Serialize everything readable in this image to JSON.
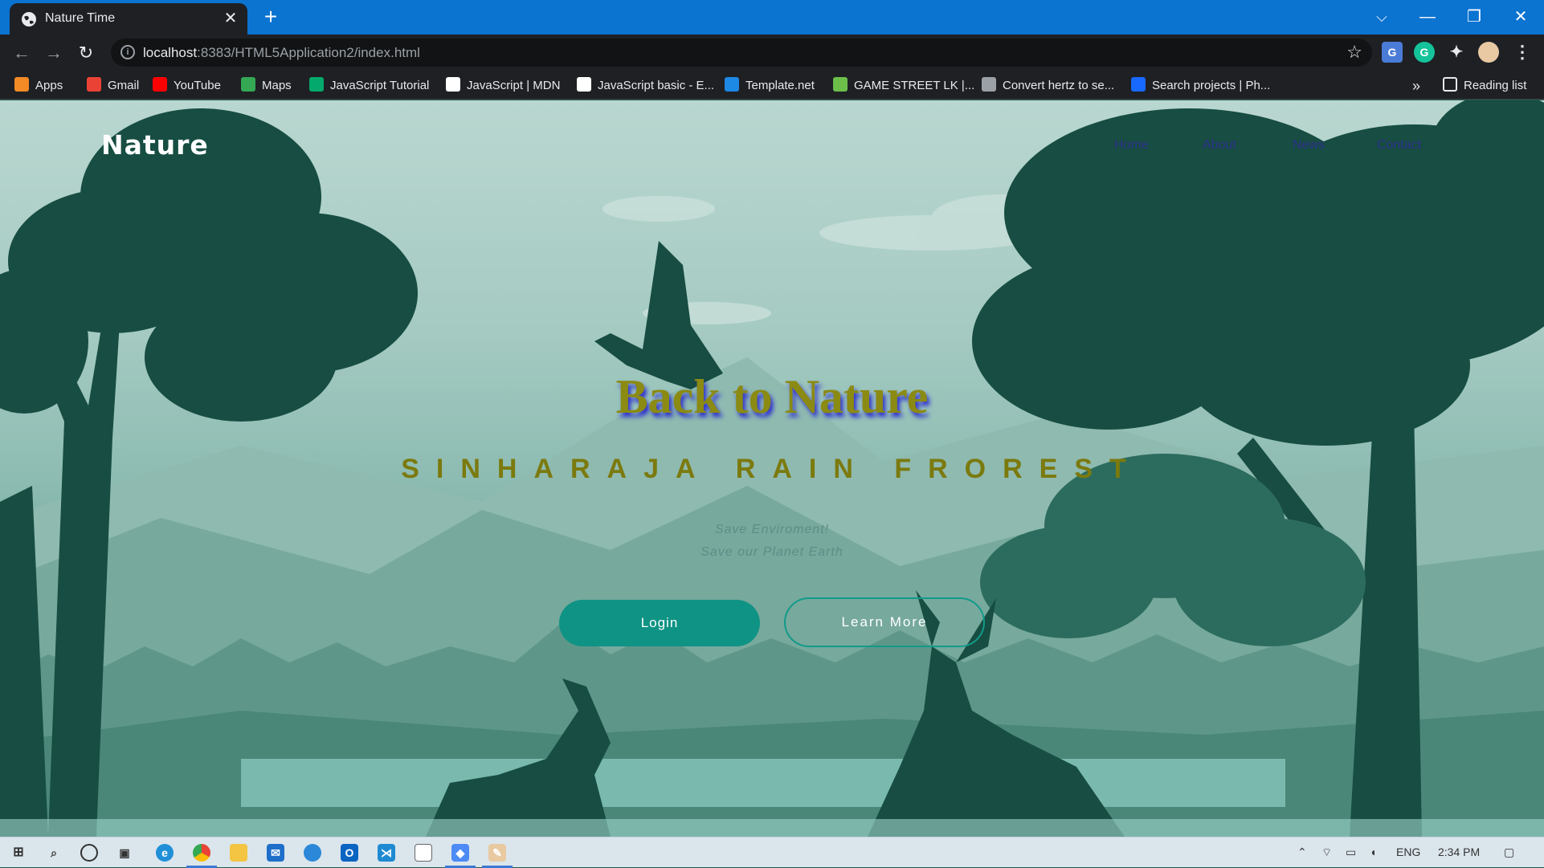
{
  "browser": {
    "tab_title": "Nature Time",
    "tab_close": "✕",
    "new_tab": "+",
    "url_host": "localhost",
    "url_path": ":8383/HTML5Application2/index.html",
    "window_controls": {
      "collapse": "⌵",
      "minimize": "—",
      "restore": "❐",
      "close": "✕"
    },
    "nav": {
      "back": "←",
      "forward": "→",
      "reload": "↻"
    },
    "star": "☆",
    "menu": "⋮",
    "bookmarks_more": "»",
    "reading_list": "Reading list",
    "bookmarks": [
      {
        "label": "Apps",
        "icon": "apps-grid-icon",
        "color": "#f28b25"
      },
      {
        "label": "Gmail",
        "icon": "gmail-icon",
        "color": "#ea4335"
      },
      {
        "label": "YouTube",
        "icon": "youtube-icon",
        "color": "#ff0000"
      },
      {
        "label": "Maps",
        "icon": "maps-pin-icon",
        "color": "#34a853"
      },
      {
        "label": "JavaScript Tutorial",
        "icon": "w3schools-icon",
        "color": "#04aa6d"
      },
      {
        "label": "JavaScript | MDN",
        "icon": "mdn-icon",
        "color": "#ffffff"
      },
      {
        "label": "JavaScript basic - E...",
        "icon": "globe-icon",
        "color": "#ffffff"
      },
      {
        "label": "Template.net",
        "icon": "template-icon",
        "color": "#1e88e5"
      },
      {
        "label": "GAME STREET LK |...",
        "icon": "gamestreet-icon",
        "color": "#6cc04a"
      },
      {
        "label": "Convert hertz to se...",
        "icon": "converter-icon",
        "color": "#9aa0a6"
      },
      {
        "label": "Search projects | Ph...",
        "icon": "behance-icon",
        "color": "#1769ff"
      }
    ]
  },
  "site": {
    "brand": "Nature",
    "nav": [
      "Home",
      "About",
      "News",
      "Contact"
    ],
    "hero_title": "Back to Nature",
    "hero_subtitle": "SINHARAJA RAIN FROREST",
    "tagline_1": "Save Enviroment!",
    "tagline_2": "Save our Planet Earth",
    "login_label": "Login",
    "learn_more_label": "Learn More"
  },
  "taskbar": {
    "language": "ENG",
    "time": "2:34 PM"
  },
  "colors": {
    "chrome_blue": "#0b73d0",
    "chrome_dark": "#1e2024",
    "accent_teal": "#0f9384",
    "title_olive": "#8b8a12",
    "nav_link": "#2c2f8a"
  }
}
